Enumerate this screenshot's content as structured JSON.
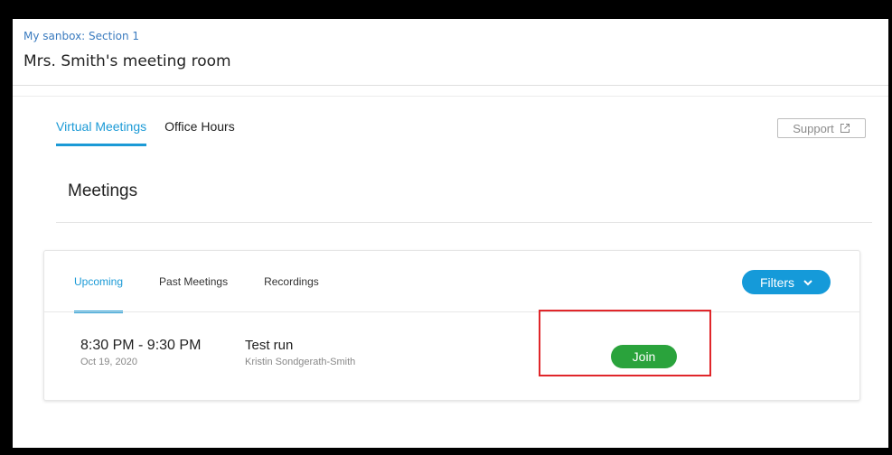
{
  "header": {
    "breadcrumb": "My sanbox: Section 1",
    "title": "Mrs. Smith's meeting room"
  },
  "tabs": [
    {
      "label": "Virtual Meetings",
      "active": true
    },
    {
      "label": "Office Hours",
      "active": false
    }
  ],
  "support": {
    "label": "Support",
    "icon": "external-link-icon"
  },
  "section": {
    "heading": "Meetings"
  },
  "subtabs": [
    {
      "label": "Upcoming",
      "active": true
    },
    {
      "label": "Past Meetings",
      "active": false
    },
    {
      "label": "Recordings",
      "active": false
    }
  ],
  "filters": {
    "label": "Filters",
    "icon": "chevron-down-icon"
  },
  "meetings": [
    {
      "time": "8:30 PM - 9:30 PM",
      "date": "Oct 19, 2020",
      "title": "Test run",
      "host": "Kristin Sondgerath-Smith",
      "join_label": "Join"
    }
  ],
  "colors": {
    "accent": "#1b9ad6",
    "join": "#2aa33c",
    "highlight": "#e0262a"
  }
}
